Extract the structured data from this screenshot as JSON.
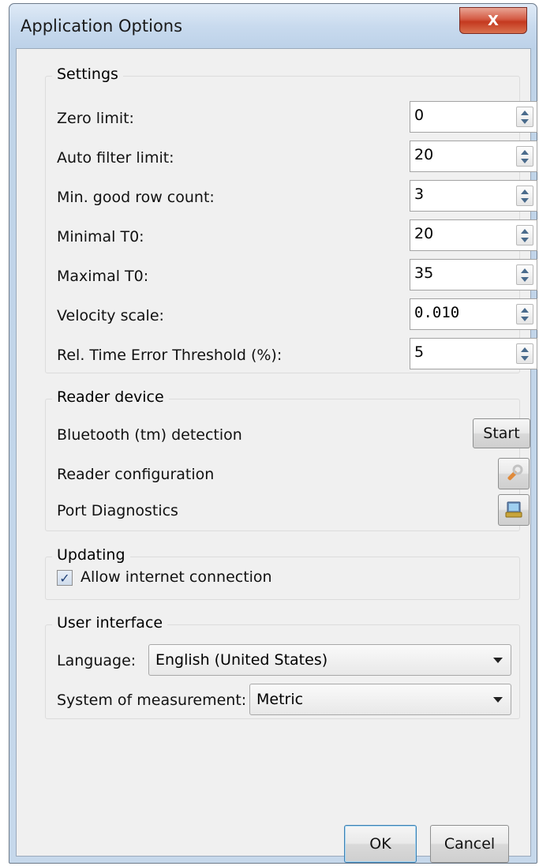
{
  "window": {
    "title": "Application Options",
    "close_label": "X"
  },
  "settings": {
    "title": "Settings",
    "rows": [
      {
        "label": "Zero limit:",
        "value": "0"
      },
      {
        "label": "Auto filter limit:",
        "value": "20"
      },
      {
        "label": "Min. good row count:",
        "value": "3"
      },
      {
        "label": "Minimal T0:",
        "value": "20"
      },
      {
        "label": "Maximal T0:",
        "value": "35"
      },
      {
        "label": "Velocity scale:",
        "value": "0.010"
      },
      {
        "label": "Rel. Time Error Threshold (%):",
        "value": "5"
      }
    ]
  },
  "reader": {
    "title": "Reader device",
    "bluetooth_label": "Bluetooth (tm) detection",
    "start_label": "Start",
    "config_label": "Reader configuration",
    "config_icon": "wrench-icon",
    "diag_label": "Port Diagnostics",
    "diag_icon": "port-diagnostics-icon"
  },
  "updating": {
    "title": "Updating",
    "allow_label": "Allow internet connection",
    "allow_checked": true
  },
  "ui": {
    "title": "User interface",
    "language_label": "Language:",
    "language_value": "English (United States)",
    "measurement_label": "System of measurement:",
    "measurement_value": "Metric"
  },
  "buttons": {
    "ok": "OK",
    "cancel": "Cancel"
  }
}
